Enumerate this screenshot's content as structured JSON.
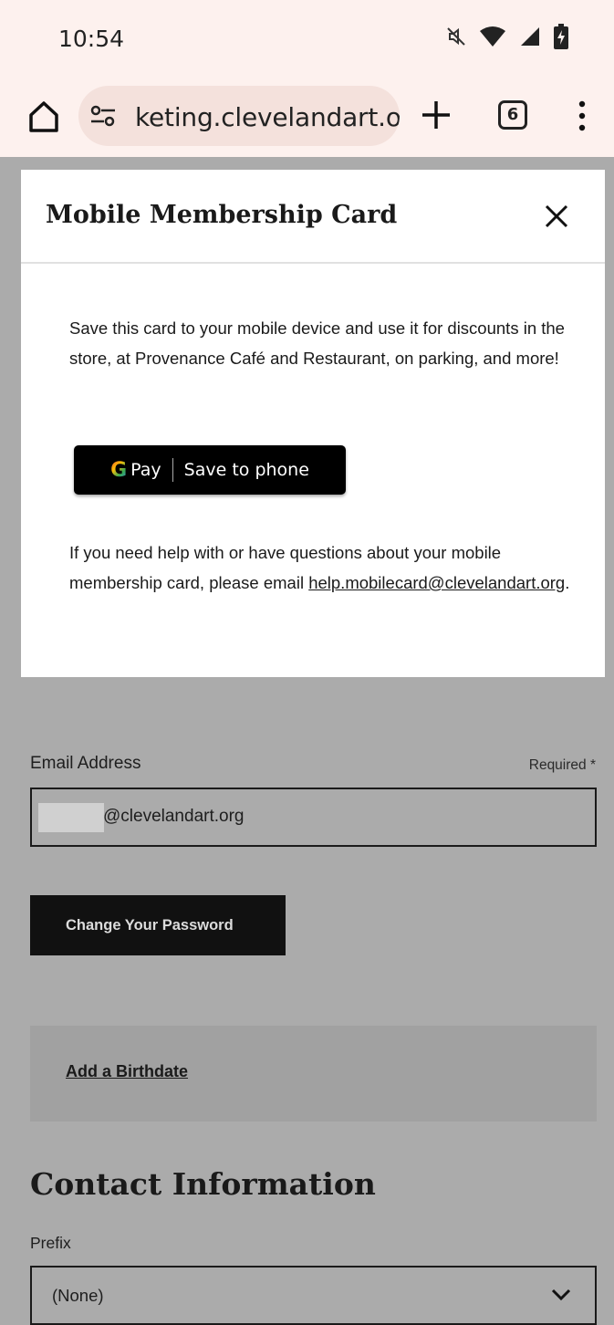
{
  "status_bar": {
    "time": "10:54",
    "icons": [
      "mute-icon",
      "wifi-icon",
      "signal-icon",
      "battery-charging-icon"
    ]
  },
  "browser": {
    "url": "ketingclevelandart.org",
    "url_display": "keting.clevelandart.org",
    "tab_count": "6"
  },
  "modal": {
    "title": "Mobile Membership Card",
    "description": "Save this card to your mobile device and use it for discounts in the store, at Provenance Café and Restaurant, on parking, and more!",
    "gpay": {
      "brand_g": "G",
      "brand_pay": "Pay",
      "action": "Save to phone"
    },
    "help_text": "If you need help with or have questions about your mobile membership card, please email",
    "help_email": "help.mobilecard@clevelandart.org",
    "help_suffix": "."
  },
  "form": {
    "email_label": "Email Address",
    "required_label": "Required *",
    "email_value": "@clevelandart.org",
    "change_password_label": "Change Your Password",
    "add_birthdate_label": "Add a Birthdate",
    "contact_heading": "Contact Information",
    "prefix_label": "Prefix",
    "prefix_value": "(None)"
  },
  "colors": {
    "chrome_bg": "#fdf1ee",
    "url_pill": "#f4e1dc",
    "overlay": "#ababab",
    "button_dark": "#111111"
  }
}
